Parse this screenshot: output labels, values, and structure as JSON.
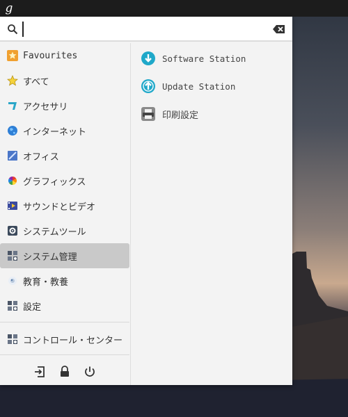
{
  "topbar": {
    "logo_glyph": "g"
  },
  "search": {
    "value": "",
    "placeholder": ""
  },
  "sidebar": {
    "categories": [
      {
        "label": "Favourites",
        "icon": "star-orange-icon"
      },
      {
        "label": "すべて",
        "icon": "star-yellow-icon"
      },
      {
        "label": "アクセサリ",
        "icon": "accessories-icon"
      },
      {
        "label": "インターネット",
        "icon": "globe-icon"
      },
      {
        "label": "オフィス",
        "icon": "office-icon"
      },
      {
        "label": "グラフィックス",
        "icon": "graphics-icon"
      },
      {
        "label": "サウンドとビデオ",
        "icon": "multimedia-icon"
      },
      {
        "label": "システムツール",
        "icon": "system-tools-icon"
      },
      {
        "label": "システム管理",
        "icon": "system-admin-icon",
        "selected": true
      },
      {
        "label": "教育・教養",
        "icon": "education-icon"
      },
      {
        "label": "設定",
        "icon": "settings-icon"
      }
    ],
    "control_center": {
      "label": "コントロール・センター",
      "icon": "control-center-icon"
    },
    "actions": [
      "logout-icon",
      "lock-icon",
      "power-icon"
    ]
  },
  "apps": [
    {
      "label": "Software Station",
      "icon": "software-station-icon",
      "color": "#1fa8c9"
    },
    {
      "label": "Update Station",
      "icon": "update-station-icon",
      "color": "#1fa8c9"
    },
    {
      "label": "印刷設定",
      "icon": "printer-icon",
      "color": "#666666"
    }
  ],
  "colors": {
    "selected_bg": "#c9c9c9",
    "menu_bg": "#f3f3f3",
    "accent": "#1fa8c9"
  }
}
